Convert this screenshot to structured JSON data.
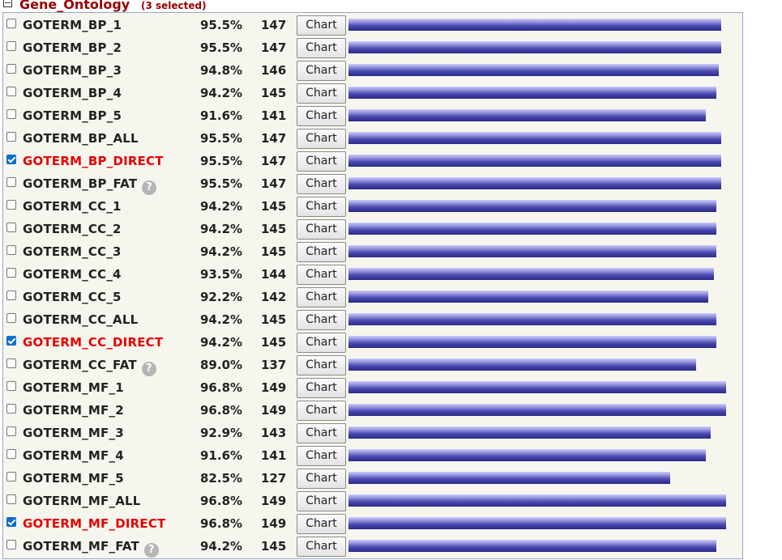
{
  "category": {
    "title": "Gene_Ontology",
    "selected_text": "(3 selected)"
  },
  "button_label": "Chart",
  "help_glyph": "?",
  "max_count": 155,
  "rows": [
    {
      "name": "GOTERM_BP_1",
      "pct": "95.5%",
      "count": "147",
      "value": 147,
      "checked": false,
      "help": false
    },
    {
      "name": "GOTERM_BP_2",
      "pct": "95.5%",
      "count": "147",
      "value": 147,
      "checked": false,
      "help": false
    },
    {
      "name": "GOTERM_BP_3",
      "pct": "94.8%",
      "count": "146",
      "value": 146,
      "checked": false,
      "help": false
    },
    {
      "name": "GOTERM_BP_4",
      "pct": "94.2%",
      "count": "145",
      "value": 145,
      "checked": false,
      "help": false
    },
    {
      "name": "GOTERM_BP_5",
      "pct": "91.6%",
      "count": "141",
      "value": 141,
      "checked": false,
      "help": false
    },
    {
      "name": "GOTERM_BP_ALL",
      "pct": "95.5%",
      "count": "147",
      "value": 147,
      "checked": false,
      "help": false
    },
    {
      "name": "GOTERM_BP_DIRECT",
      "pct": "95.5%",
      "count": "147",
      "value": 147,
      "checked": true,
      "help": false
    },
    {
      "name": "GOTERM_BP_FAT",
      "pct": "95.5%",
      "count": "147",
      "value": 147,
      "checked": false,
      "help": true
    },
    {
      "name": "GOTERM_CC_1",
      "pct": "94.2%",
      "count": "145",
      "value": 145,
      "checked": false,
      "help": false
    },
    {
      "name": "GOTERM_CC_2",
      "pct": "94.2%",
      "count": "145",
      "value": 145,
      "checked": false,
      "help": false
    },
    {
      "name": "GOTERM_CC_3",
      "pct": "94.2%",
      "count": "145",
      "value": 145,
      "checked": false,
      "help": false
    },
    {
      "name": "GOTERM_CC_4",
      "pct": "93.5%",
      "count": "144",
      "value": 144,
      "checked": false,
      "help": false
    },
    {
      "name": "GOTERM_CC_5",
      "pct": "92.2%",
      "count": "142",
      "value": 142,
      "checked": false,
      "help": false
    },
    {
      "name": "GOTERM_CC_ALL",
      "pct": "94.2%",
      "count": "145",
      "value": 145,
      "checked": false,
      "help": false
    },
    {
      "name": "GOTERM_CC_DIRECT",
      "pct": "94.2%",
      "count": "145",
      "value": 145,
      "checked": true,
      "help": false
    },
    {
      "name": "GOTERM_CC_FAT",
      "pct": "89.0%",
      "count": "137",
      "value": 137,
      "checked": false,
      "help": true
    },
    {
      "name": "GOTERM_MF_1",
      "pct": "96.8%",
      "count": "149",
      "value": 149,
      "checked": false,
      "help": false
    },
    {
      "name": "GOTERM_MF_2",
      "pct": "96.8%",
      "count": "149",
      "value": 149,
      "checked": false,
      "help": false
    },
    {
      "name": "GOTERM_MF_3",
      "pct": "92.9%",
      "count": "143",
      "value": 143,
      "checked": false,
      "help": false
    },
    {
      "name": "GOTERM_MF_4",
      "pct": "91.6%",
      "count": "141",
      "value": 141,
      "checked": false,
      "help": false
    },
    {
      "name": "GOTERM_MF_5",
      "pct": "82.5%",
      "count": "127",
      "value": 127,
      "checked": false,
      "help": false
    },
    {
      "name": "GOTERM_MF_ALL",
      "pct": "96.8%",
      "count": "149",
      "value": 149,
      "checked": false,
      "help": false
    },
    {
      "name": "GOTERM_MF_DIRECT",
      "pct": "96.8%",
      "count": "149",
      "value": 149,
      "checked": true,
      "help": false
    },
    {
      "name": "GOTERM_MF_FAT",
      "pct": "94.2%",
      "count": "145",
      "value": 145,
      "checked": false,
      "help": true
    }
  ]
}
